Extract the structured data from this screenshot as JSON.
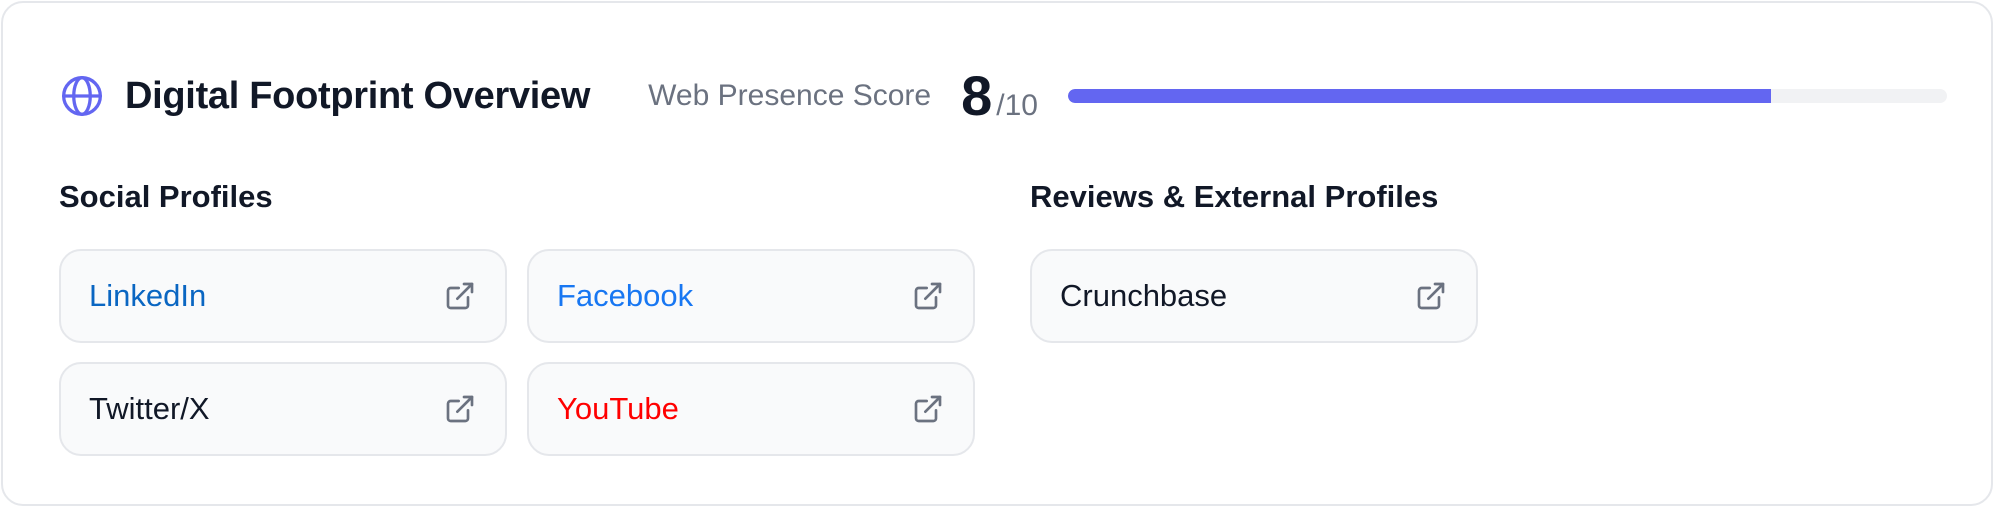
{
  "header": {
    "icon": "globe-icon",
    "title": "Digital Footprint Overview",
    "score_label": "Web Presence Score",
    "score_value": "8",
    "score_max": "/10",
    "score_fraction": 0.8,
    "accent_color": "#6366f1"
  },
  "social": {
    "heading": "Social Profiles",
    "items": [
      {
        "label": "LinkedIn",
        "color": "#0a66c2",
        "icon": "external-link-icon"
      },
      {
        "label": "Facebook",
        "color": "#1877f2",
        "icon": "external-link-icon"
      },
      {
        "label": "Twitter/X",
        "color": "#111827",
        "icon": "external-link-icon"
      },
      {
        "label": "YouTube",
        "color": "#ff0000",
        "icon": "external-link-icon"
      }
    ]
  },
  "reviews": {
    "heading": "Reviews & External Profiles",
    "items": [
      {
        "label": "Crunchbase",
        "color": "#111827",
        "icon": "external-link-icon"
      }
    ]
  }
}
